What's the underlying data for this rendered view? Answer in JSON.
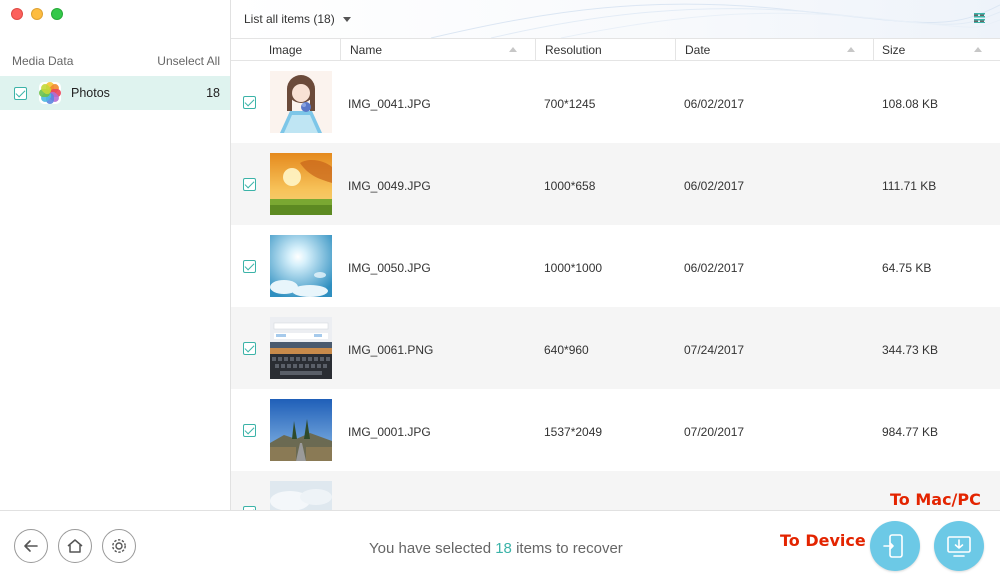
{
  "sidebar": {
    "header_title": "Media Data",
    "unselect_all": "Unselect All",
    "items": [
      {
        "label": "Photos",
        "count": "18",
        "checked": true,
        "icon": "photos-icon"
      }
    ]
  },
  "toolbar": {
    "filter_label": "List all items (18)",
    "view_grid_icon": "grid-view-icon",
    "view_list_icon": "list-view-icon"
  },
  "table": {
    "columns": [
      "Image",
      "Name",
      "Resolution",
      "Date",
      "Size"
    ],
    "rows": [
      {
        "name": "IMG_0041.JPG",
        "resolution": "700*1245",
        "date": "06/02/2017",
        "size": "108.08 KB",
        "checked": true
      },
      {
        "name": "IMG_0049.JPG",
        "resolution": "1000*658",
        "date": "06/02/2017",
        "size": "111.71 KB",
        "checked": true
      },
      {
        "name": "IMG_0050.JPG",
        "resolution": "1000*1000",
        "date": "06/02/2017",
        "size": "64.75 KB",
        "checked": true
      },
      {
        "name": "IMG_0061.PNG",
        "resolution": "640*960",
        "date": "07/24/2017",
        "size": "344.73 KB",
        "checked": true
      },
      {
        "name": "IMG_0001.JPG",
        "resolution": "1537*2049",
        "date": "07/20/2017",
        "size": "984.77 KB",
        "checked": true
      }
    ]
  },
  "bottom": {
    "status_prefix": "You have selected",
    "status_count": "18",
    "status_suffix": "items to recover",
    "to_device_label": "To Device",
    "to_mac_label": "To Mac/PC"
  },
  "colors": {
    "accent": "#3bb3a8",
    "selected_bg": "#dff3ef",
    "action_button": "#6cc9e6",
    "annotation": "#e32400"
  }
}
